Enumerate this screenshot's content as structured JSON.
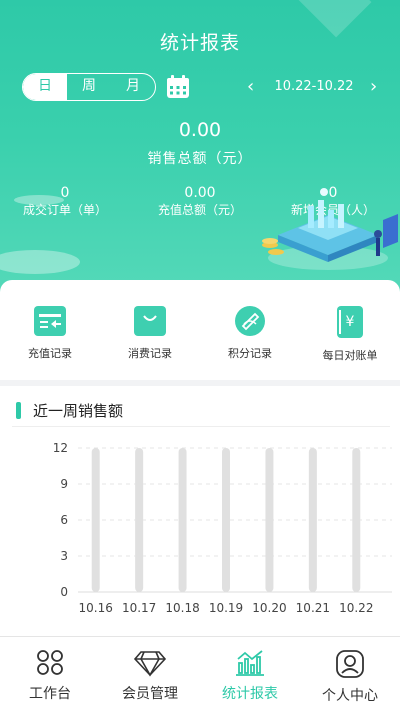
{
  "header": {
    "title": "统计报表",
    "segments": [
      "日",
      "周",
      "月"
    ],
    "active_segment": "日",
    "date_range": "10.22-10.22",
    "prev_glyph": "‹",
    "next_glyph": "›"
  },
  "summary": {
    "total_value": "0.00",
    "total_label": "销售总额（元）",
    "stats": [
      {
        "value": "0",
        "label": "成交订单（单）"
      },
      {
        "value": "0.00",
        "label": "充值总额（元）"
      },
      {
        "value": "0",
        "label": "新增会员（人）"
      }
    ]
  },
  "quick_actions": [
    {
      "label": "充值记录",
      "icon": "recharge-record-icon"
    },
    {
      "label": "消费记录",
      "icon": "shopping-bag-icon"
    },
    {
      "label": "积分记录",
      "icon": "points-record-icon"
    },
    {
      "label": "每日对账单",
      "icon": "daily-statement-icon"
    }
  ],
  "chart_section": {
    "title": "近一周销售额"
  },
  "chart_data": {
    "type": "bar",
    "title": "近一周销售额",
    "categories": [
      "10.16",
      "10.17",
      "10.18",
      "10.19",
      "10.20",
      "10.21",
      "10.22"
    ],
    "values": [
      0,
      0,
      0,
      0,
      0,
      0,
      0
    ],
    "yticks": [
      0,
      3,
      6,
      9,
      12
    ],
    "ylim": [
      0,
      12
    ],
    "grid": true,
    "bar_color": "#e0e0e0"
  },
  "tabbar": [
    {
      "label": "工作台",
      "icon": "workbench-icon",
      "active": false
    },
    {
      "label": "会员管理",
      "icon": "diamond-icon",
      "active": false
    },
    {
      "label": "统计报表",
      "icon": "statistics-chart-icon",
      "active": true
    },
    {
      "label": "个人中心",
      "icon": "profile-icon",
      "active": false
    }
  ],
  "colors": {
    "accent": "#2ec9a8",
    "hero_top": "#2ec9a8",
    "hero_bottom": "#55d9b9",
    "text_dark": "#333333"
  }
}
